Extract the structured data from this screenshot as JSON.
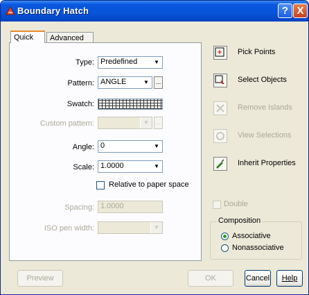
{
  "window": {
    "title": "Boundary Hatch",
    "help_glyph": "?",
    "close_glyph": "X"
  },
  "tabs": [
    {
      "label": "Quick",
      "active": true
    },
    {
      "label": "Advanced",
      "active": false
    }
  ],
  "fields": {
    "type": {
      "label": "Type:",
      "value": "Predefined"
    },
    "pattern": {
      "label": "Pattern:",
      "value": "ANGLE",
      "browse": "..."
    },
    "swatch": {
      "label": "Swatch:"
    },
    "custom_pattern": {
      "label": "Custom pattern:",
      "value": "",
      "browse": "..."
    },
    "angle": {
      "label": "Angle:",
      "value": "0"
    },
    "scale": {
      "label": "Scale:",
      "value": "1.0000"
    },
    "relative": {
      "label": "Relative to paper space",
      "checked": false
    },
    "spacing": {
      "label": "Spacing:",
      "value": "1.0000"
    },
    "iso_pen_width": {
      "label": "ISO pen width:",
      "value": ""
    }
  },
  "actions": [
    {
      "label": "Pick Points",
      "icon": "pick-points-icon",
      "enabled": true
    },
    {
      "label": "Select Objects",
      "icon": "select-objects-icon",
      "enabled": true
    },
    {
      "label": "Remove Islands",
      "icon": "remove-islands-icon",
      "enabled": false
    },
    {
      "label": "View Selections",
      "icon": "view-selections-icon",
      "enabled": false
    },
    {
      "label": "Inherit Properties",
      "icon": "inherit-properties-icon",
      "enabled": true
    }
  ],
  "double": {
    "label": "Double",
    "checked": false
  },
  "composition": {
    "title": "Composition",
    "options": [
      {
        "label": "Associative",
        "selected": true
      },
      {
        "label": "Nonassociative",
        "selected": false
      }
    ]
  },
  "buttons": {
    "preview": "Preview",
    "ok": "OK",
    "cancel": "Cancel",
    "help": "Help"
  },
  "colors": {
    "titlebar": "#0753d8",
    "dialog_bg": "#ece9d8",
    "tab_accent": "#e68b2c",
    "disabled_text": "#aca899"
  }
}
